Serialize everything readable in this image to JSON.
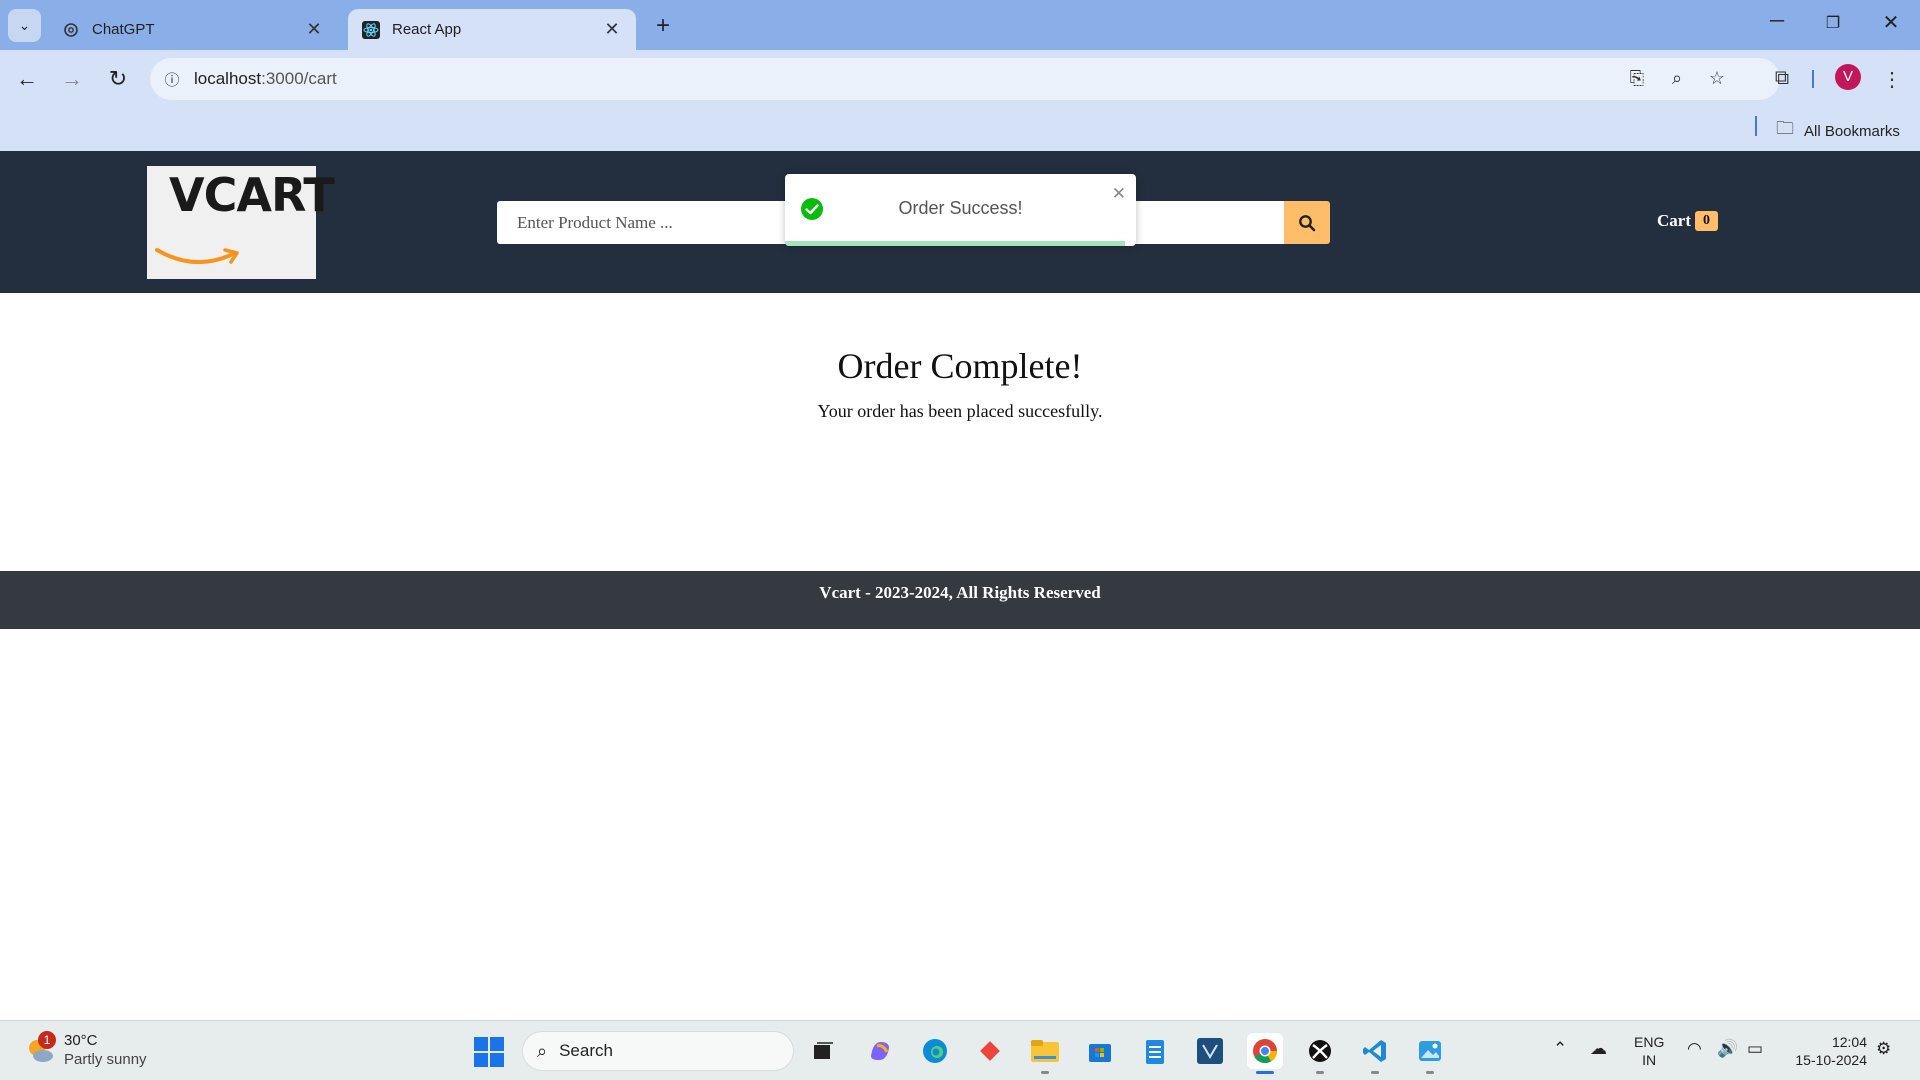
{
  "browser": {
    "tabs": [
      {
        "title": "ChatGPT",
        "active": false
      },
      {
        "title": "React App",
        "active": true
      }
    ],
    "url_host": "localhost",
    "url_path": ":3000/cart",
    "profile_initial": "V",
    "bookmarks_label": "All Bookmarks"
  },
  "site": {
    "logo_text": "VCART",
    "search_placeholder": "Enter Product Name ...",
    "cart_label": "Cart",
    "cart_count": "0",
    "accent_color": "#febd69",
    "header_color": "#232f3e"
  },
  "toast": {
    "message": "Order Success!",
    "progress": 0.97
  },
  "main": {
    "heading": "Order Complete!",
    "message": "Your order has been placed succesfully."
  },
  "footer": {
    "text": "Vcart - 2023-2024, All Rights Reserved"
  },
  "taskbar": {
    "weather_temp": "30°C",
    "weather_condition": "Partly sunny",
    "weather_badge": "1",
    "search_label": "Search",
    "lang_line1": "ENG",
    "lang_line2": "IN",
    "time": "12:04",
    "date": "15-10-2024"
  }
}
